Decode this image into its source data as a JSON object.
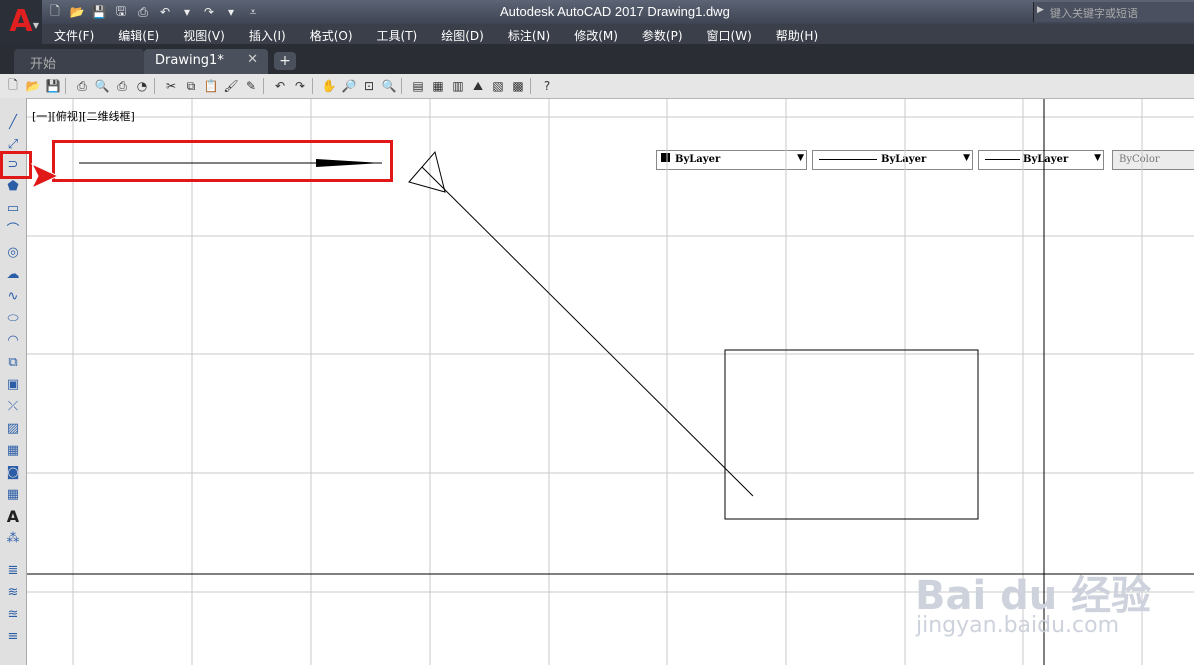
{
  "window": {
    "title": "Autodesk AutoCAD 2017    Drawing1.dwg",
    "search_placeholder": "键入关键字或短语"
  },
  "menu": [
    "文件(F)",
    "编辑(E)",
    "视图(V)",
    "插入(I)",
    "格式(O)",
    "工具(T)",
    "绘图(D)",
    "标注(N)",
    "修改(M)",
    "参数(P)",
    "窗口(W)",
    "帮助(H)"
  ],
  "tabs": {
    "start": "开始",
    "doc": "Drawing1*"
  },
  "properties": {
    "color": "ByLayer",
    "linetype": "ByLayer",
    "lineweight": "ByLayer",
    "plotstyle": "ByColor"
  },
  "viewport_label": "[一][俯视][二维线框]",
  "colors": {
    "highlight": "#e01818",
    "titlebar": "#3e4452",
    "grid": "#c8c8c8"
  },
  "watermark": {
    "main": "Bai du 经验",
    "sub": "jingyan.baidu.com"
  },
  "icons": {
    "app": "autocad-logo-icon",
    "highlighted_tool": "arc-icon"
  }
}
